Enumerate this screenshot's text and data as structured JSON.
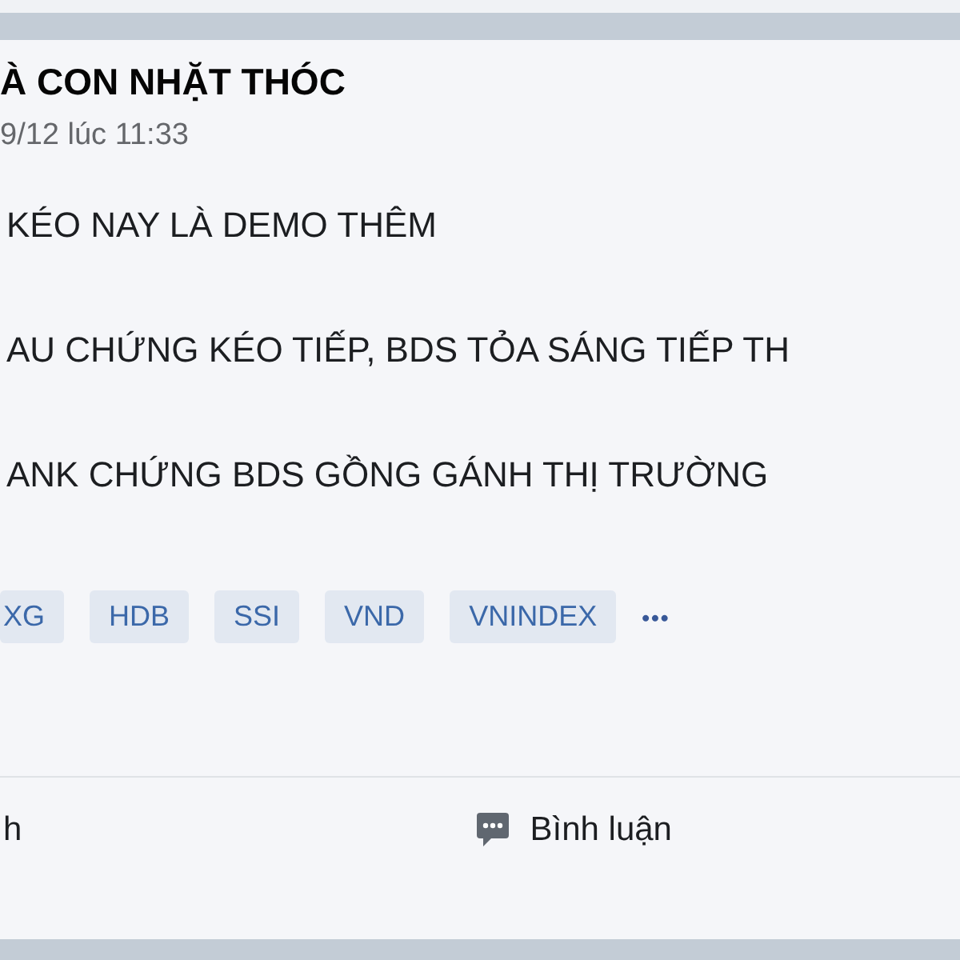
{
  "post": {
    "author": "À CON NHẶT THÓC",
    "timestamp": "9/12 lúc 11:33",
    "lines": [
      "KÉO NAY LÀ DEMO THÊM",
      "AU CHỨNG KÉO TIẾP, BDS TỎA SÁNG TIẾP TH",
      "ANK CHỨNG BDS GỒNG GÁNH THỊ TRƯỜNG"
    ],
    "tags": [
      "XG",
      "HDB",
      "SSI",
      "VND",
      "VNINDEX"
    ],
    "more": "•••",
    "actions": [
      {
        "kind": "like",
        "label": "h"
      },
      {
        "kind": "comment",
        "label": "Bình luận"
      }
    ]
  }
}
